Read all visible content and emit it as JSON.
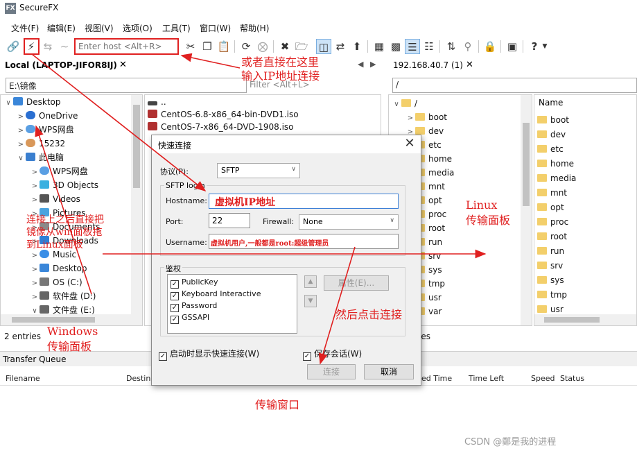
{
  "window": {
    "title": "SecureFX",
    "logo": "FX"
  },
  "menu": [
    "文件(F)",
    "编辑(E)",
    "视图(V)",
    "选项(O)",
    "工具(T)",
    "窗口(W)",
    "帮助(H)"
  ],
  "toolbar": {
    "host_placeholder": "Enter host <Alt+R>"
  },
  "local": {
    "tab": "Local (LAPTOP-JIFOR8IJ)",
    "path": "E:\\镜像",
    "filter": "Filter <Alt+L>",
    "tree": [
      {
        "label": "Desktop"
      },
      {
        "label": "OneDrive"
      },
      {
        "label": "WPS网盘"
      },
      {
        "label": "15232"
      },
      {
        "label": "此电脑"
      },
      {
        "label": "WPS网盘"
      },
      {
        "label": "3D Objects"
      },
      {
        "label": "Videos"
      },
      {
        "label": "Pictures"
      },
      {
        "label": "Documents"
      },
      {
        "label": "Downloads"
      },
      {
        "label": "Music"
      },
      {
        "label": "Desktop"
      },
      {
        "label": "OS (C:)"
      },
      {
        "label": "软件盘 (D:)"
      },
      {
        "label": "文件盘 (E:)"
      }
    ],
    "files": [
      "..",
      "CentOS-6.8-x86_64-bin-DVD1.iso",
      "CentOS-7-x86_64-DVD-1908.iso"
    ],
    "status": "2 entries"
  },
  "remote": {
    "tab": "192.168.40.7 (1)",
    "path": "/",
    "root": "/",
    "tree": [
      "boot",
      "dev",
      "etc",
      "home",
      "media",
      "mnt",
      "opt",
      "proc",
      "root",
      "run",
      "srv",
      "sys",
      "tmp",
      "usr",
      "var"
    ],
    "name_header": "Name",
    "list": [
      "boot",
      "dev",
      "etc",
      "home",
      "media",
      "mnt",
      "opt",
      "proc",
      "root",
      "run",
      "srv",
      "sys",
      "tmp",
      "usr"
    ],
    "status_fragment": "ies"
  },
  "queue": {
    "title": "Transfer Queue",
    "columns": [
      "Filename",
      "Destina",
      "ed Time",
      "Time Left",
      "Speed",
      "Status"
    ]
  },
  "dialog": {
    "title": "快速连接",
    "protocol_label": "协议(P):",
    "protocol_value": "SFTP",
    "group_sftp": "SFTP login",
    "hostname_label": "Hostname:",
    "hostname_value": "虚拟机IP地址",
    "port_label": "Port:",
    "port_value": "22",
    "firewall_label": "Firewall:",
    "firewall_value": "None",
    "username_label": "Username:",
    "username_value": "虚拟机用户,一般都是root:超级管理员",
    "auth_group": "鉴权",
    "auth_items": [
      "PublicKey",
      "Keyboard Interactive",
      "Password",
      "GSSAPI"
    ],
    "properties_button": "属性(E)...",
    "show_on_startup": "启动时显示快速连接(W)",
    "save_session": "保存会话(W)",
    "connect_button": "连接",
    "cancel_button": "取消"
  },
  "annotations": {
    "direct_line1": "或者直接在这里",
    "direct_line2": "输入IP地址连接",
    "drag_line1": "连接上之后直接把",
    "drag_line2": "镜像从win面板拖",
    "drag_line3": "到Linux面板",
    "linux_line1": "Linux",
    "linux_line2": "传输面板",
    "windows_line1": "Windows",
    "windows_line2": "传输面板",
    "click_connect": "然后点击连接",
    "transfer_window": "传输窗口"
  },
  "watermark": "CSDN @鄭是我的进程",
  "colors": {
    "annotation": "#e02020",
    "folder": "#f3cf6b"
  }
}
